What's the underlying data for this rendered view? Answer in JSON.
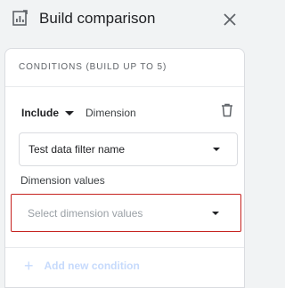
{
  "header": {
    "title": "Build comparison",
    "icon": "comparison-chart-icon",
    "close_icon": "close-icon"
  },
  "conditions": {
    "heading": "CONDITIONS (BUILD UP TO 5)",
    "include_label": "Include",
    "dimension_label": "Dimension",
    "delete_icon": "trash-icon",
    "dimension_select_value": "Test data filter name",
    "dimension_values_label": "Dimension values",
    "dimension_values_placeholder": "Select dimension values",
    "add_condition_label": "Add new condition"
  },
  "colors": {
    "error_border": "#c5221f",
    "disabled_blue": "#c6dafc"
  }
}
